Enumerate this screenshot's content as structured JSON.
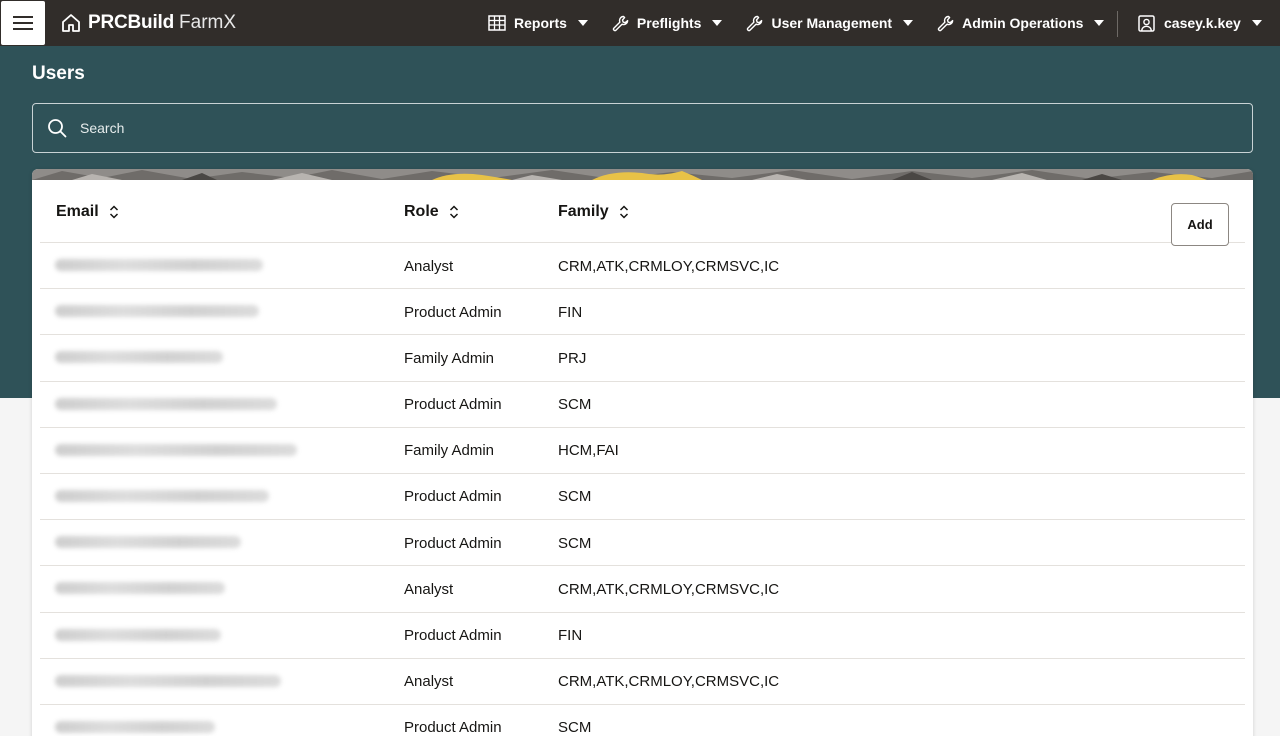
{
  "app": {
    "brand_bold": "PRCBuild",
    "brand_light": "FarmX"
  },
  "nav": [
    {
      "label": "Reports",
      "icon": "table-icon"
    },
    {
      "label": "Preflights",
      "icon": "wrench-icon"
    },
    {
      "label": "User Management",
      "icon": "wrench-icon"
    },
    {
      "label": "Admin Operations",
      "icon": "wrench-icon"
    }
  ],
  "user": {
    "name": "casey.k.key"
  },
  "page": {
    "title": "Users"
  },
  "search": {
    "placeholder": "Search"
  },
  "table": {
    "columns": [
      {
        "label": "Email"
      },
      {
        "label": "Role"
      },
      {
        "label": "Family"
      }
    ],
    "add_label": "Add",
    "rows": [
      {
        "role": "Analyst",
        "family": "CRM,ATK,CRMLOY,CRMSVC,IC"
      },
      {
        "role": "Product Admin",
        "family": "FIN"
      },
      {
        "role": "Family Admin",
        "family": "PRJ"
      },
      {
        "role": "Product Admin",
        "family": "SCM"
      },
      {
        "role": "Family Admin",
        "family": "HCM,FAI"
      },
      {
        "role": "Product Admin",
        "family": "SCM"
      },
      {
        "role": "Product Admin",
        "family": "SCM"
      },
      {
        "role": "Analyst",
        "family": "CRM,ATK,CRMLOY,CRMSVC,IC"
      },
      {
        "role": "Product Admin",
        "family": "FIN"
      },
      {
        "role": "Analyst",
        "family": "CRM,ATK,CRMLOY,CRMSVC,IC"
      },
      {
        "role": "Product Admin",
        "family": "SCM"
      }
    ]
  },
  "colors": {
    "header_bg": "#312d2a",
    "band_bg": "#2f5258",
    "accent_yellow": "#e8c247"
  }
}
